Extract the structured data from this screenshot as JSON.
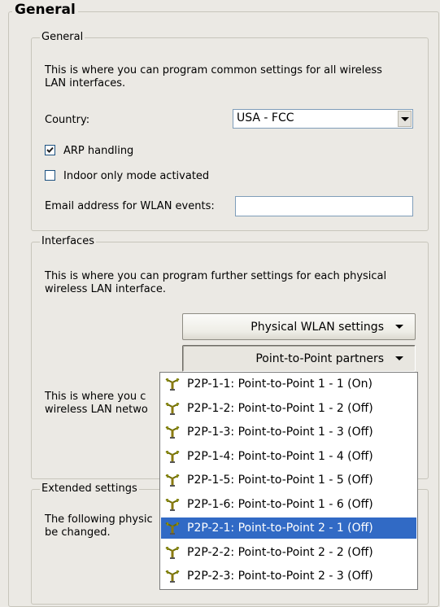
{
  "outer_title": "General",
  "general_group": {
    "title": "General",
    "description_line1": "This is where you can program common settings for all wireless",
    "description_line2": "LAN interfaces.",
    "country_label": "Country:",
    "country_value": "USA - FCC",
    "arp_label": "ARP handling",
    "arp_checked": true,
    "indoor_label": "Indoor only mode activated",
    "indoor_checked": false,
    "email_label": "Email address for WLAN events:",
    "email_value": ""
  },
  "interfaces_group": {
    "title": "Interfaces",
    "description_line1": "This is where you can program further settings for each physical",
    "description_line2": "wireless LAN interface.",
    "physical_button": "Physical WLAN settings",
    "p2p_button": "Point-to-Point partners",
    "partial_line1": "This is where you c",
    "partial_line2": "wireless LAN netwo"
  },
  "extended_group": {
    "title": "Extended settings",
    "partial_line1": "The following physic",
    "partial_line2": "be changed."
  },
  "dropdown": {
    "items": [
      "P2P-1-1: Point-to-Point 1 - 1 (On)",
      "P2P-1-2: Point-to-Point 1 - 2 (Off)",
      "P2P-1-3: Point-to-Point 1 - 3 (Off)",
      "P2P-1-4: Point-to-Point 1 - 4 (Off)",
      "P2P-1-5: Point-to-Point 1 - 5 (Off)",
      "P2P-1-6: Point-to-Point 1 - 6 (Off)",
      "P2P-2-1: Point-to-Point 2 - 1 (Off)",
      "P2P-2-2: Point-to-Point 2 - 2 (Off)",
      "P2P-2-3: Point-to-Point 2 - 3 (Off)"
    ],
    "selected_item": "P2P-2-1: Point-to-Point 2 - 1 (Off)",
    "item_icon": "antenna-icon"
  },
  "colors": {
    "selection": "#316ac5",
    "background": "#ebe9e4"
  }
}
